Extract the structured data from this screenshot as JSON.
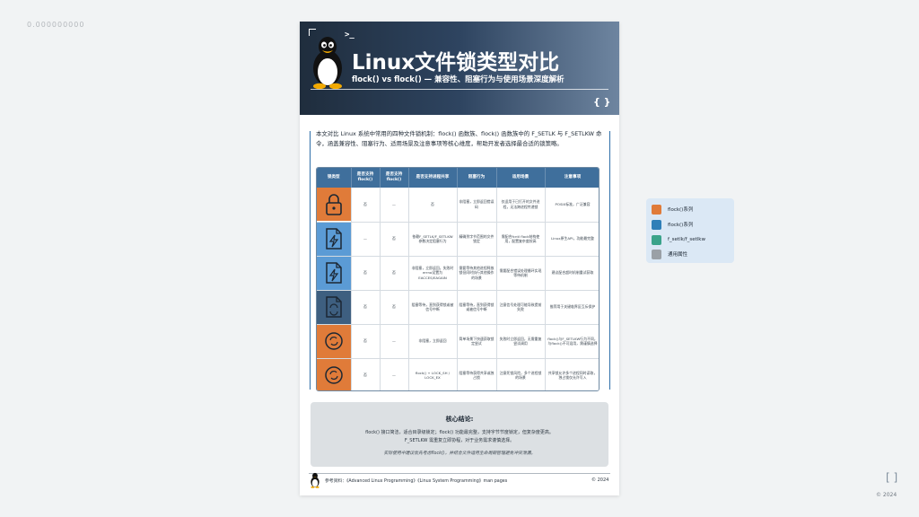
{
  "page": {
    "top_left_text": "0.000000000",
    "corner_bracket": "[ ]",
    "corner_copyright": "© 2024"
  },
  "poster": {
    "header": {
      "prompt_icon": ">_",
      "title": "Linux文件锁类型对比",
      "subtitle": "flock() vs flock() — 兼容性、阻塞行为与使用场景深度解析",
      "braces": "{ }"
    },
    "intro": "本文对比 Linux 系统中常用的四种文件锁机制：flock() 函数族、flock() 函数族中的 F_SETLK 与 F_SETLKW 命令，涵盖兼容性、阻塞行为、适用场景及注意事项等核心维度，帮助开发者选择最合适的锁策略。",
    "table": {
      "headers": [
        "锁类型",
        "是否支持\nflock()",
        "是否支持\nflock()",
        "是否支持进程共享",
        "阻塞行为",
        "适用场景",
        "注意事项"
      ],
      "rows": [
        {
          "icon": "padlock-icon",
          "color": "#e07b39",
          "cells": [
            "否",
            "—",
            "否",
            "非阻塞，立即返回错误码",
            "仅适用于已打开的文件进程，无法跨进程传递锁",
            "POSIX标准，广泛兼容"
          ]
        },
        {
          "icon": "file-lightning-icon",
          "color": "#5b9bd5",
          "cells": [
            "—",
            "否",
            "依赖F_SETLK/F_SETLKW参数决定阻塞行为",
            "精确到字节范围的文件锁定",
            "需配合fcntl flock结构使用，配置复杂度较高",
            "Linux原生API，功能最完整"
          ]
        },
        {
          "icon": "file-lightning-icon",
          "color": "#5b9bd5",
          "cells": [
            "否",
            "否",
            "非阻塞，立即返回，失败时errno设置为EACCES/EAGAIN",
            "需要等待其他进程释放锁但同时执行其他操作的场景",
            "需要配合错误处理循环实现等待机制",
            "建议配合超时机制重试获取"
          ]
        },
        {
          "icon": "file-sync-icon",
          "color": "#3e5f80",
          "cells": [
            "否",
            "否",
            "阻塞等待，直到获得锁或被信号中断",
            "阻塞等待，直到获得锁或被信号中断",
            "注意信号处理可能导致提前失败",
            "推荐用于关键临界区互斥保护"
          ]
        },
        {
          "icon": "record-sync-icon",
          "color": "#e07b39",
          "cells": [
            "否",
            "—",
            "非阻塞，立即返回",
            "简单场景下快速获取锁定尝试",
            "失败时立即返回，无需重复尝试调用",
            "flock()与F_SETLKW行为不同，与flock()不可混用，需谨慎选择"
          ]
        },
        {
          "icon": "record-sync-icon",
          "color": "#e07b39",
          "cells": [
            "否",
            "—",
            "flock() + LOCK_SH / LOCK_EX",
            "阻塞等待获得共享或独占锁",
            "注意死锁风险，多个进程锁的场景",
            "共享锁允许多个进程同时读取，独占锁仅允许写入"
          ]
        }
      ]
    },
    "conclusion": {
      "title": "核心结论:",
      "line1": "flock() 接口简洁，适合目录级锁定；flock() 功能最完整，支持字节节度锁定，但复杂度更高。",
      "line2": "F_SETLKW 需重复立即协程，对于业务需求谨慎选择。",
      "italic": "实际使用中建议优先考虑flock()，并结合文件适用生命周期管理避免冲突泄漏。"
    },
    "footer": {
      "reference": "参考资料：《Advanced Linux Programming》《Linux System Programming》man pages",
      "copyright": "© 2024"
    }
  },
  "legend": {
    "items": [
      {
        "label": "flock()系列",
        "color": "#e07b39"
      },
      {
        "label": "flock()系列",
        "color": "#2f7fb8"
      },
      {
        "label": "f_setlk/f_setlkw",
        "color": "#3aa38a"
      },
      {
        "label": "通用属性",
        "color": "#9aa0a6"
      }
    ]
  }
}
